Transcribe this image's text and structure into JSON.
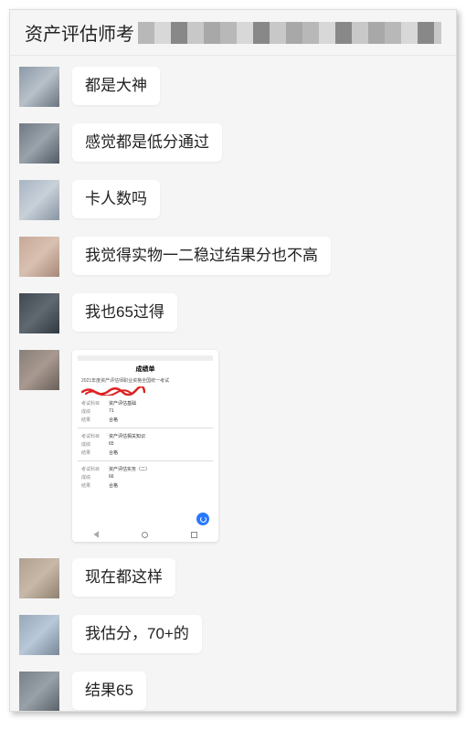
{
  "header": {
    "title": "资产评估师考"
  },
  "messages": [
    {
      "type": "text",
      "avatar_class": "av-1",
      "text": "都是大神"
    },
    {
      "type": "text",
      "avatar_class": "av-2",
      "text": "感觉都是低分通过"
    },
    {
      "type": "text",
      "avatar_class": "av-3",
      "text": "卡人数吗"
    },
    {
      "type": "text",
      "avatar_class": "av-4",
      "text": "我觉得实物一二稳过结果分也不高"
    },
    {
      "type": "text",
      "avatar_class": "av-5",
      "text": "我也65过得"
    },
    {
      "type": "image",
      "avatar_class": "av-6"
    },
    {
      "type": "text",
      "avatar_class": "av-7",
      "text": "现在都这样"
    },
    {
      "type": "text",
      "avatar_class": "av-8",
      "text": "我估分，70+的"
    },
    {
      "type": "text",
      "avatar_class": "av-9",
      "text": "结果65"
    }
  ],
  "screenshot_card": {
    "title": "成绩单",
    "heading": "2021年度资产评估师职业资格全国统一考试",
    "rows": [
      {
        "lbl": "考试科目",
        "val": "资产评估基础"
      },
      {
        "lbl": "成绩",
        "val": "71"
      },
      {
        "lbl": "结果",
        "val": "合格"
      },
      {
        "lbl": "考试科目",
        "val": "资产评估相关知识"
      },
      {
        "lbl": "成绩",
        "val": "65"
      },
      {
        "lbl": "结果",
        "val": "合格"
      },
      {
        "lbl": "考试科目",
        "val": "资产评估实务（二）"
      },
      {
        "lbl": "成绩",
        "val": "66"
      },
      {
        "lbl": "结果",
        "val": "合格"
      }
    ]
  }
}
